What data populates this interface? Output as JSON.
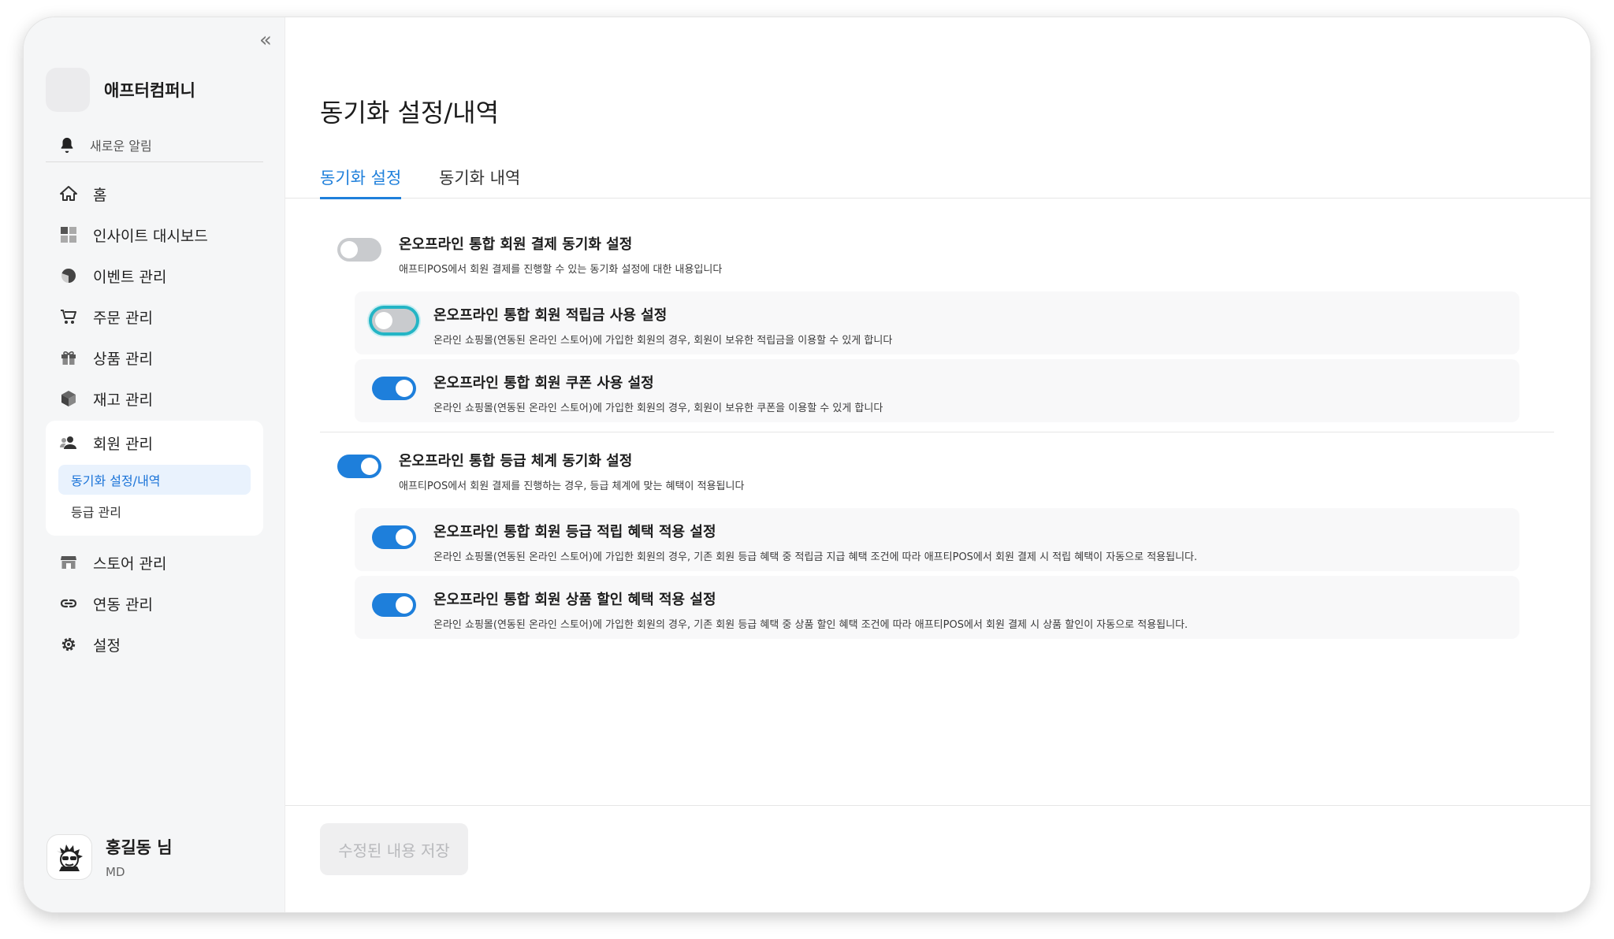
{
  "sidebar": {
    "company_name": "애프터컴퍼니",
    "notice_label": "새로운 알림",
    "collapse_icon": "double-chevron-left-icon",
    "nav": [
      {
        "label": "홈",
        "icon": "home-icon"
      },
      {
        "label": "인사이트 대시보드",
        "icon": "dashboard-icon"
      },
      {
        "label": "이벤트 관리",
        "icon": "pie-chart-icon"
      },
      {
        "label": "주문 관리",
        "icon": "cart-icon"
      },
      {
        "label": "상품 관리",
        "icon": "gift-icon"
      },
      {
        "label": "재고 관리",
        "icon": "box-icon"
      },
      {
        "label": "회원 관리",
        "icon": "users-icon"
      },
      {
        "label": "스토어 관리",
        "icon": "store-icon"
      },
      {
        "label": "연동 관리",
        "icon": "link-icon"
      },
      {
        "label": "설정",
        "icon": "gear-icon"
      }
    ],
    "member_sub": [
      {
        "label": "동기화 설정/내역",
        "active": true
      },
      {
        "label": "등급 관리",
        "active": false
      }
    ],
    "user": {
      "name": "홍길동 님",
      "role": "MD"
    }
  },
  "main": {
    "title": "동기화 설정/내역",
    "tabs": [
      {
        "label": "동기화 설정",
        "active": true
      },
      {
        "label": "동기화 내역",
        "active": false
      }
    ],
    "settings": [
      {
        "title": "온오프라인 통합 회원 결제 동기화 설정",
        "desc": "애프티POS에서 회원 결제를 진행할 수 있는 동기화 설정에 대한 내용입니다",
        "on": false
      },
      {
        "title": "온오프라인 통합 회원 적립금 사용 설정",
        "desc": "온라인 쇼핑몰(연동된 온라인 스토어)에 가입한 회원의 경우, 회원이 보유한 적립금을 이용할 수 있게 합니다",
        "on": false
      },
      {
        "title": "온오프라인 통합 회원 쿠폰 사용 설정",
        "desc": "온라인 쇼핑몰(연동된 온라인 스토어)에 가입한 회원의 경우, 회원이 보유한 쿠폰을 이용할 수 있게 합니다",
        "on": true
      },
      {
        "title": "온오프라인 통합 등급 체계 동기화 설정",
        "desc": "애프티POS에서 회원 결제를 진행하는 경우, 등급 체계에 맞는 혜택이 적용됩니다",
        "on": true
      },
      {
        "title": "온오프라인 통합 회원 등급 적립 혜택 적용 설정",
        "desc": "온라인 쇼핑몰(연동된 온라인 스토어)에 가입한 회원의 경우, 기존 회원 등급 혜택 중 적립금 지급 혜택 조건에 따라 애프티POS에서 회원 결제 시 적립 혜택이 자동으로 적용됩니다.",
        "on": true
      },
      {
        "title": "온오프라인 통합 회원 상품 할인 혜택 적용 설정",
        "desc": "온라인 쇼핑몰(연동된 온라인 스토어)에 가입한 회원의 경우, 기존 회원 등급 혜택 중 상품 할인 혜택 조건에 따라 애프티POS에서 회원 결제 시 상품 할인이 자동으로 적용됩니다.",
        "on": true
      }
    ],
    "save_label": "수정된 내용 저장"
  },
  "colors": {
    "accent": "#1e7fdb",
    "focus_ring": "#24b5c5",
    "toggle_off": "#c9cbce"
  }
}
